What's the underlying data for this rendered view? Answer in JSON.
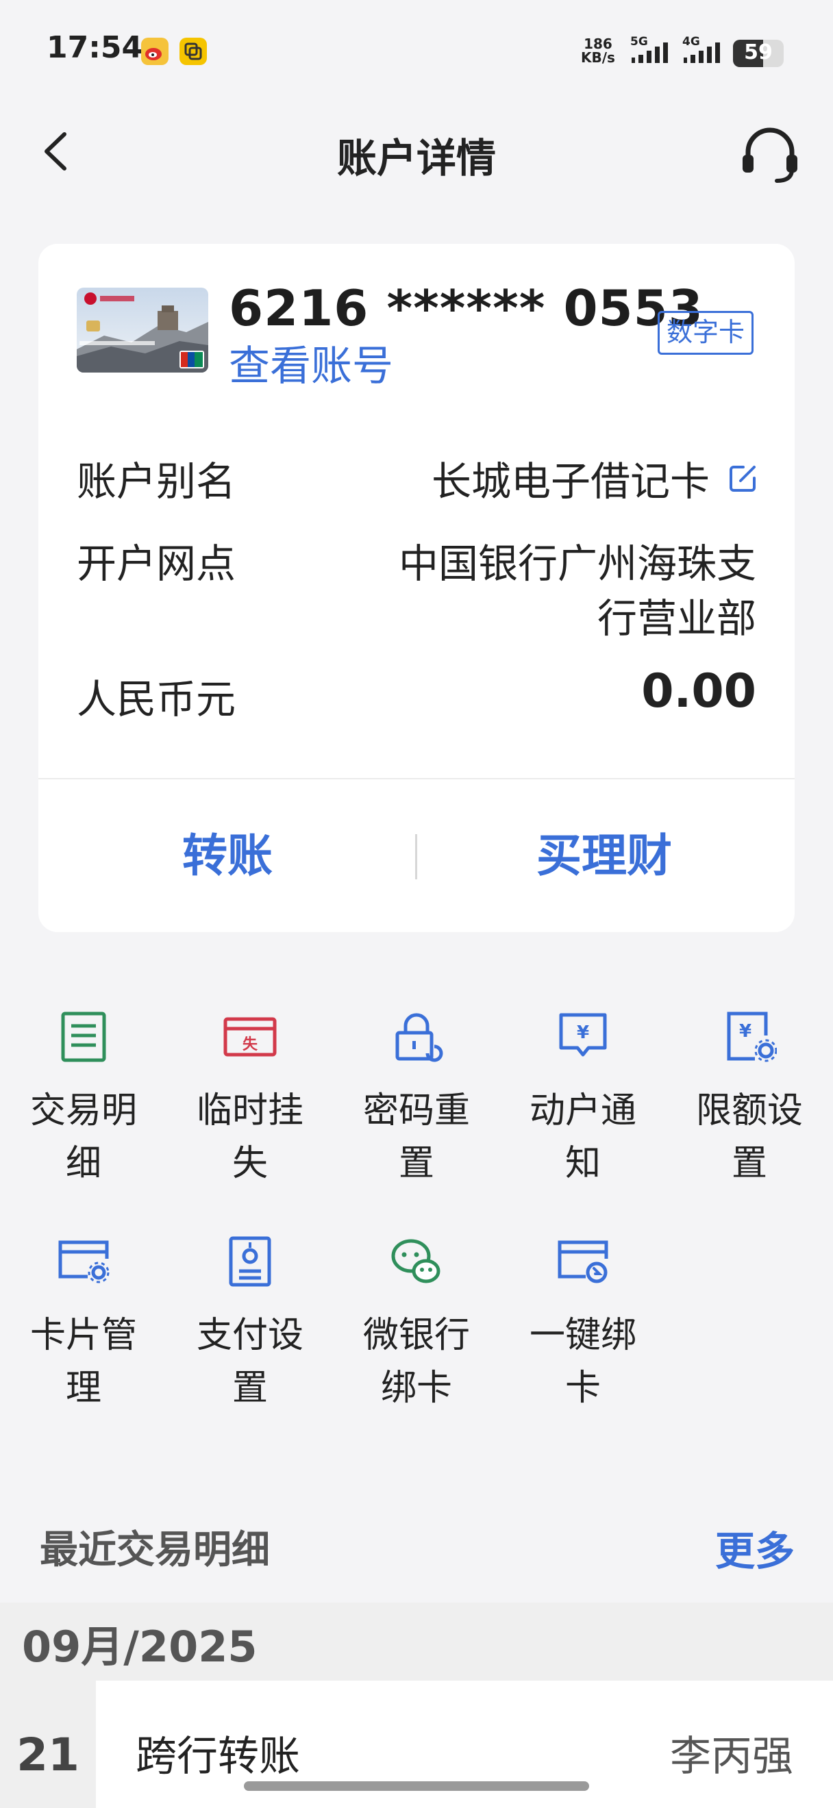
{
  "status_bar": {
    "time": "17:54",
    "net_speed_value": "186",
    "net_speed_unit": "KB/s",
    "signal_1": "5G",
    "signal_2": "4G",
    "battery": "59"
  },
  "header": {
    "title": "账户详情",
    "back_icon": "chevron-left-icon",
    "service_icon": "headset-icon"
  },
  "account_card": {
    "card_number": "6216 ****** 0553",
    "view_number_link": "查看账号",
    "badge": "数字卡",
    "alias_label": "账户别名",
    "alias_value": "长城电子借记卡",
    "branch_label": "开户网点",
    "branch_value_line1": "中国银行广州海珠支",
    "branch_value_line2": "行营业部",
    "currency_label": "人民币元",
    "balance": "0.00"
  },
  "actions": {
    "transfer": "转账",
    "buy_wealth": "买理财"
  },
  "services": [
    {
      "line1": "交易明",
      "line2": "细",
      "icon": "transaction-list-icon"
    },
    {
      "line1": "临时挂",
      "line2": "失",
      "icon": "report-loss-icon"
    },
    {
      "line1": "密码重",
      "line2": "置",
      "icon": "password-reset-icon"
    },
    {
      "line1": "动户通",
      "line2": "知",
      "icon": "account-notice-icon"
    },
    {
      "line1": "限额设",
      "line2": "置",
      "icon": "limit-setting-icon"
    },
    {
      "line1": "卡片管",
      "line2": "理",
      "icon": "card-manage-icon"
    },
    {
      "line1": "支付设",
      "line2": "置",
      "icon": "payment-setting-icon"
    },
    {
      "line1": "微银行",
      "line2": "绑卡",
      "icon": "wechat-bank-icon"
    },
    {
      "line1": "一键绑",
      "line2": "卡",
      "icon": "one-click-bind-icon"
    }
  ],
  "recent": {
    "title": "最近交易明细",
    "more": "更多",
    "month": "09月/2025",
    "transactions": [
      {
        "day": "21",
        "name": "跨行转账",
        "party": "李丙强"
      }
    ]
  },
  "colors": {
    "accent": "#3a6fd8",
    "green_icon": "#2f8f5b",
    "red_icon": "#d2394a"
  }
}
